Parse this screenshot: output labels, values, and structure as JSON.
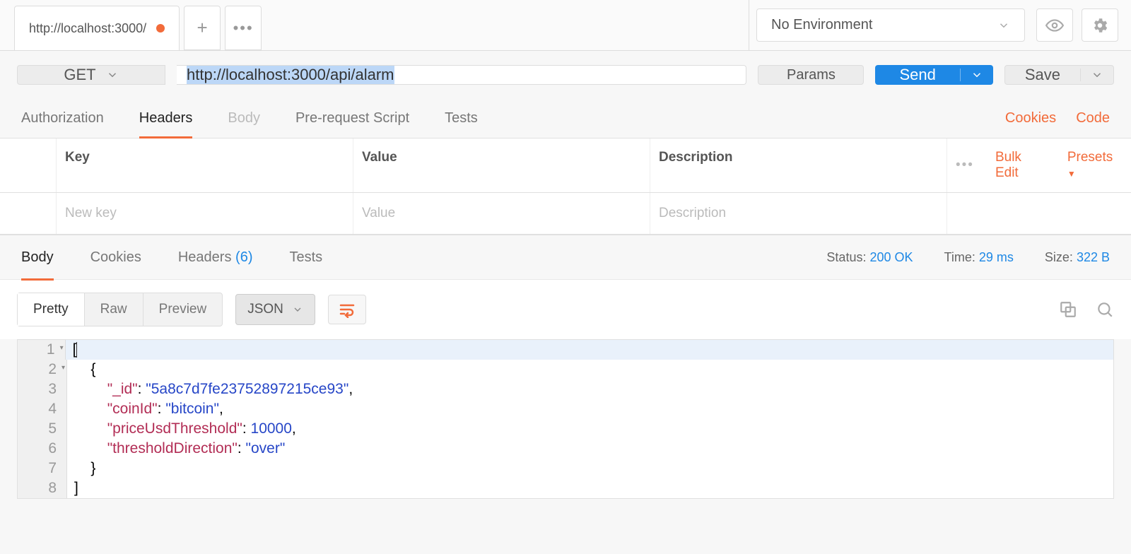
{
  "top": {
    "tab_title": "http://localhost:3000/",
    "environment": "No Environment"
  },
  "request": {
    "method": "GET",
    "url": "http://localhost:3000/api/alarm",
    "params_label": "Params",
    "send_label": "Send",
    "save_label": "Save"
  },
  "req_tabs": {
    "authorization": "Authorization",
    "headers": "Headers",
    "body": "Body",
    "prerequest": "Pre-request Script",
    "tests": "Tests",
    "cookies": "Cookies",
    "code": "Code"
  },
  "headers_table": {
    "col_key": "Key",
    "col_value": "Value",
    "col_desc": "Description",
    "bulk_edit": "Bulk Edit",
    "presets": "Presets",
    "ph_key": "New key",
    "ph_value": "Value",
    "ph_desc": "Description"
  },
  "resp_tabs": {
    "body": "Body",
    "cookies": "Cookies",
    "headers": "Headers",
    "headers_count": "(6)",
    "tests": "Tests"
  },
  "resp_meta": {
    "status_label": "Status:",
    "status_value": "200 OK",
    "time_label": "Time:",
    "time_value": "29 ms",
    "size_label": "Size:",
    "size_value": "322 B"
  },
  "body_bar": {
    "pretty": "Pretty",
    "raw": "Raw",
    "preview": "Preview",
    "format": "JSON"
  },
  "response_body": {
    "id_key": "\"_id\"",
    "id_val": "\"5a8c7d7fe23752897215ce93\"",
    "coin_key": "\"coinId\"",
    "coin_val": "\"bitcoin\"",
    "price_key": "\"priceUsdThreshold\"",
    "price_val": "10000",
    "dir_key": "\"thresholdDirection\"",
    "dir_val": "\"over\""
  },
  "lines": {
    "l1": "1",
    "l2": "2",
    "l3": "3",
    "l4": "4",
    "l5": "5",
    "l6": "6",
    "l7": "7",
    "l8": "8"
  }
}
